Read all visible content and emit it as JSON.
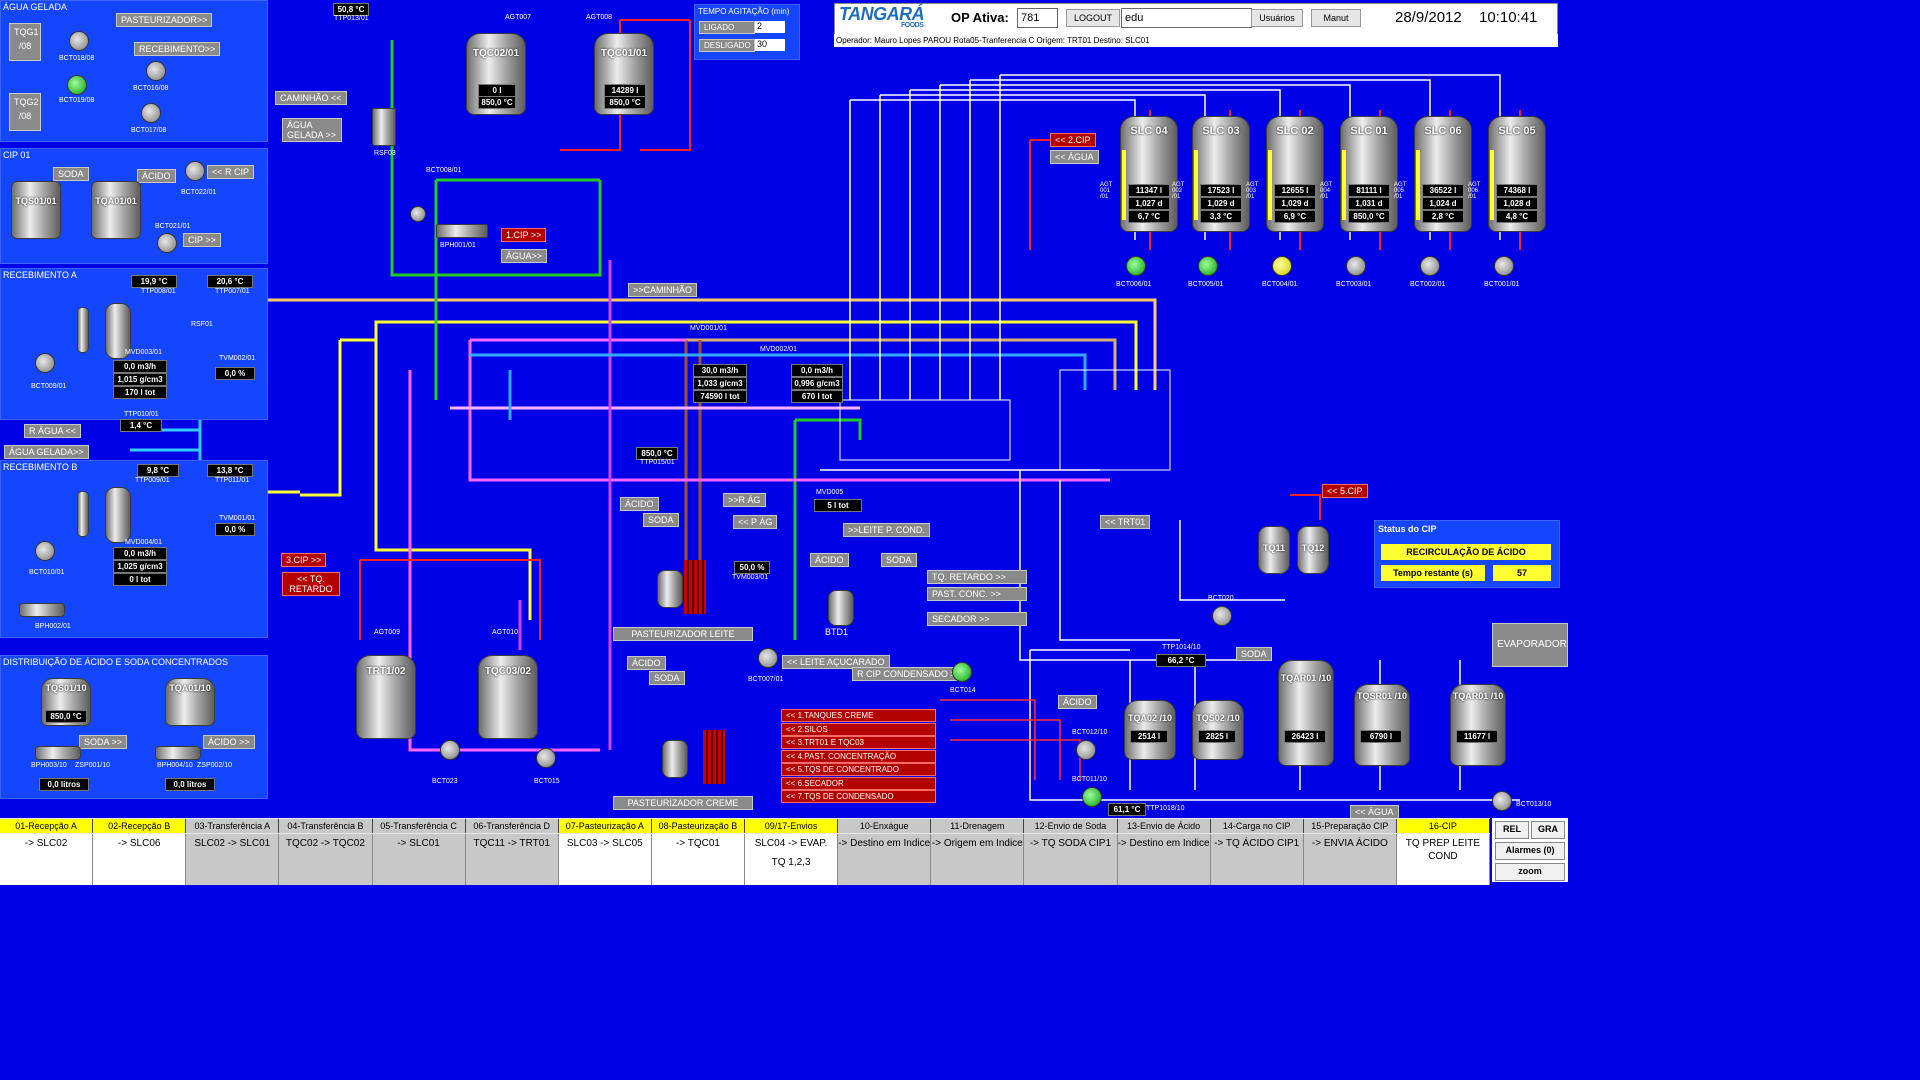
{
  "header": {
    "logo": "TANGARÁ",
    "logo_sub": "FOODS",
    "op_label": "OP Ativa:",
    "op_value": "781",
    "logout": "LOGOUT",
    "user": "edu",
    "users_btn": "Usuários",
    "manut_btn": "Manut",
    "date": "28/9/2012",
    "time": "10:10:41",
    "operator_line": "Operador: Mauro Lopes PAROU  Rota05-Tranferencia C Origem: TRT01 Destino: SLC01"
  },
  "agitation": {
    "title": "TEMPO AGITAÇÃO (min)",
    "on_label": "LIGADO",
    "on_value": "2",
    "off_label": "DESLIGADO",
    "off_value": "30"
  },
  "panels": {
    "agua_gelada": "ÁGUA GELADA",
    "cip01": "CIP 01",
    "rec_a": "RECEBIMENTO A",
    "rec_b": "RECEBIMENTO B",
    "dist": "DISTRIBUIÇÃO DE ÁCIDO E SODA CONCENTRADOS"
  },
  "left": {
    "tqg1": "TQG1 /08",
    "tqg2": "TQG2 /08",
    "pasteurizador_btn": "PASTEURIZADOR>>",
    "recebimento_btn": "RECEBIMENTO>>",
    "bct018": "BCT018/08",
    "bct019": "BCT019/08",
    "bct016": "BCT016/08",
    "bct017": "BCT017/08",
    "soda": "SODA",
    "acido": "ÁCIDO",
    "r_cip": "<< R CIP",
    "cip_out": "CIP >>",
    "tqs01": "TQS01/01",
    "tqa01": "TQA01/01",
    "bct022": "BCT022/01",
    "bct021": "BCT021/01",
    "rec_a_t1": "19,9 °C",
    "rec_a_t2": "20,6 °C",
    "ttp008": "TTP008/01",
    "ttp007": "TTP007/01",
    "rsf01": "RSF01",
    "mvd003": "MVD003/01",
    "rec_a_flow": "0,0 m3/h",
    "rec_a_dens": "1,015 g/cm3",
    "rec_a_tot": "170 l tot",
    "tvm002": "TVM002/01",
    "tvm002_v": "0,0 %",
    "bct009": "BCT009/01",
    "ttp010": "TTP010/01",
    "t_agua": "1,4 °C",
    "r_agua": "R ÁGUA <<",
    "agua_gelada_btn": "ÁGUA GELADA>>",
    "rec_b_t1": "9,8 °C",
    "rec_b_t2": "13,8 °C",
    "ttp009": "TTP009/01",
    "ttp011": "TTP011/01",
    "mvd004": "MVD004/01",
    "rec_b_flow": "0,0 m3/h",
    "rec_b_dens": "1,025 g/cm3",
    "rec_b_tot": "0 l tot",
    "tvm001": "TVM001/01",
    "tvm001_v": "0,0 %",
    "bct010": "BCT010/01",
    "bph002": "BPH002/01",
    "tqs01_10": "TQS01/10",
    "tqs01_10_t": "850,0 °C",
    "tqa01_10": "TQA01/10",
    "soda_btn": "SODA >>",
    "acido_btn": "ÁCIDO >>",
    "bph003": "BPH003/10",
    "zsp001": "ZSP001/10",
    "bph004": "BPH004/10",
    "zsp002": "ZSP002/10",
    "liters1": "0,0 litros",
    "liters2": "0,0 litros"
  },
  "center": {
    "t_top": "50,8 °C",
    "ttp013": "TTP013/01",
    "caminhao": "CAMINHÃO <<",
    "agua_gelada": "ÁGUA GELADA >>",
    "rsf03": "RSF03",
    "tqc02": "TQC02/01",
    "tqc02_l": "0 l",
    "tqc02_t": "850,0 °C",
    "tqc01": "TQC01/01",
    "tqc01_l": "14289 l",
    "tqc01_t": "850,0 °C",
    "agt007": "AGT007",
    "agt008": "AGT008",
    "bct008": "BCT008/01",
    "bph001": "BPH001/01",
    "cip1": "1.CIP >>",
    "agua_out": "ÁGUA>>",
    "caminhao_out": ">>CAMINHÃO",
    "mvd001": "MVD001/01",
    "mvd001_flow": "30,0 m3/h",
    "mvd001_dens": "1,033 g/cm3",
    "mvd001_tot": "74590 l tot",
    "mvd002": "MVD002/01",
    "mvd002_flow": "0,0 m3/h",
    "mvd002_dens": "0,996 g/cm3",
    "mvd002_tot": "670 l tot",
    "ttp015_v": "850,0 °C",
    "ttp015": "TTP015/01",
    "cip3": "3.CIP >>",
    "tq_retardo": "<< TQ. RETARDO",
    "trt01": "TRT1/02",
    "tqc03": "TQC03/02",
    "agt009": "AGT009",
    "agt010": "AGT010",
    "bct023": "BCT023",
    "bct015": "BCT015",
    "acido": "ÁCIDO",
    "soda": "SODA",
    "past_leite": "PASTEURIZADOR LEITE",
    "past_creme": "PASTEURIZADOR CREME",
    "r_ag": ">>R ÁG",
    "p_ag": "<< P ÁG",
    "tvm003": "TVM003/01",
    "tvm003_v": "50,0 %",
    "mvd005": "MVD005",
    "mvd005_tot": "5 l tot",
    "leite_p_cond": ">>LEITE P. COND.",
    "btd1": "BTD1",
    "leite_acucarado": "<< LEITE AÇUCARADO",
    "bct007": "BCT007/01"
  },
  "right": {
    "cip2": "<< 2.CIP",
    "agua": "<< ÁGUA",
    "cip5": "<< 5.CIP",
    "trt01_in": "<< TRT01",
    "tq11": "TQ11",
    "tq12": "TQ12",
    "bct020": "BCT020",
    "tq_retardo": "TQ. RETARDO >>",
    "past_conc": "PAST. CONC. >>",
    "secador": "SECADOR >>",
    "r_cip_cond": "R CIP CONDENSADO >>",
    "bct014": "BCT014",
    "ttp1014_v": "66,2 °C",
    "ttp1014": "TTP1014/10",
    "soda": "SODA",
    "acido": "ÁCIDO",
    "tqa02_10": "TQA02 /10",
    "tqa02_v": "2514 l",
    "tqs02_10": "TQS02 /10",
    "tqs02_v": "2825 l",
    "tqar01": "TQAR01 /10",
    "tqar01_v": "26423 l",
    "tqsr01": "TQSR01 /10",
    "tqsr01_v": "6790 l",
    "tqar01b": "TQAR01 /10",
    "tqar01b_v": "11677 l",
    "evaporador": "EVAPORADOR",
    "bct012": "BCT012/10",
    "bct011": "BCT011/10",
    "ttp1018_v": "61,1 °C",
    "ttp1018": "TTP1018/10",
    "agua_in": "<< ÁGUA",
    "bct013": "BCT013/10",
    "status_cip": "Status do CIP",
    "status_state": "RECIRCULAÇÃO DE ÁCIDO",
    "remaining_label": "Tempo restante (s)",
    "remaining": "57",
    "dest": [
      "<< 1.TANQUES CREME",
      "<< 2.SILOS",
      "<< 3.TRT01 E TQC03",
      "<< 4.PAST. CONCENTRAÇÃO",
      "<< 5.TQS DE CONCENTRADO",
      "<< 6.SECADOR",
      "<< 7.TQS DE CONDENSADO"
    ]
  },
  "silos": [
    {
      "name": "SLC 04",
      "vol": "11347 l",
      "dens": "1,027 d",
      "temp": "6,7 °C",
      "pump": "BCT006/01",
      "agt": "AGT 001 /01"
    },
    {
      "name": "SLC 03",
      "vol": "17523 l",
      "dens": "1,029 d",
      "temp": "3,3 °C",
      "pump": "BCT005/01",
      "agt": "AGT 002 /01"
    },
    {
      "name": "SLC 02",
      "vol": "12655 l",
      "dens": "1,029 d",
      "temp": "6,9 °C",
      "pump": "BCT004/01",
      "agt": "AGT 003 /01"
    },
    {
      "name": "SLC 01",
      "vol": "81111 l",
      "dens": "1,031 d",
      "temp": "850,0 °C",
      "pump": "BCT003/01",
      "agt": "AGT 004 /01"
    },
    {
      "name": "SLC 06",
      "vol": "36522 l",
      "dens": "1,024 d",
      "temp": "2,8 °C",
      "pump": "BCT002/01",
      "agt": "AGT 005 /01"
    },
    {
      "name": "SLC 05",
      "vol": "74368 l",
      "dens": "1,028 d",
      "temp": "4,8 °C",
      "pump": "BCT001/01",
      "agt": "AGT 006 /01"
    }
  ],
  "tabs": [
    {
      "label": "01-Recepção A",
      "value": "-> SLC02",
      "bg": "#ffff00"
    },
    {
      "label": "02-Recepção B",
      "value": "-> SLC06",
      "bg": "#ffff00"
    },
    {
      "label": "03-Transferência A",
      "value": "SLC02 -> SLC01",
      "bg": "#c8c8c8"
    },
    {
      "label": "04-Transferência B",
      "value": "TQC02 -> TQC02",
      "bg": "#c8c8c8"
    },
    {
      "label": "05-Transferência C",
      "value": "-> SLC01",
      "bg": "#c8c8c8"
    },
    {
      "label": "06-Transferência D",
      "value": "TQC11 -> TRT01",
      "bg": "#c8c8c8"
    },
    {
      "label": "07-Pasteurização A",
      "value": "SLC03 -> SLC05",
      "bg": "#ffff00"
    },
    {
      "label": "08-Pasteurização B",
      "value": "-> TQC01",
      "bg": "#ffff00"
    },
    {
      "label": "09/17-Envios",
      "value": "SLC04 -> EVAP.",
      "value2": "TQ 1,2,3",
      "bg": "#ffff00"
    },
    {
      "label": "10-Enxágue",
      "value": "-> Destino em Indice",
      "bg": "#c8c8c8"
    },
    {
      "label": "11-Drenagem",
      "value": "-> Origem em Indice",
      "bg": "#c8c8c8"
    },
    {
      "label": "12-Envio de Soda",
      "value": "-> TQ SODA CIP1",
      "bg": "#c8c8c8"
    },
    {
      "label": "13-Envio de Ácido",
      "value": "-> Destino em Indice",
      "bg": "#c8c8c8"
    },
    {
      "label": "14-Carga no CIP",
      "value": "-> TQ ÁCIDO CIP1",
      "bg": "#c8c8c8"
    },
    {
      "label": "15-Preparação CIP",
      "value": "-> ENVIA ÁCIDO",
      "bg": "#c8c8c8"
    },
    {
      "label": "16-CIP",
      "value": "TQ PREP LEITE COND",
      "bg": "#ffff00"
    }
  ],
  "side_buttons": {
    "rel": "REL",
    "gra": "GRA",
    "alarmes": "Alarmes (0)",
    "zoom": "zoom"
  }
}
